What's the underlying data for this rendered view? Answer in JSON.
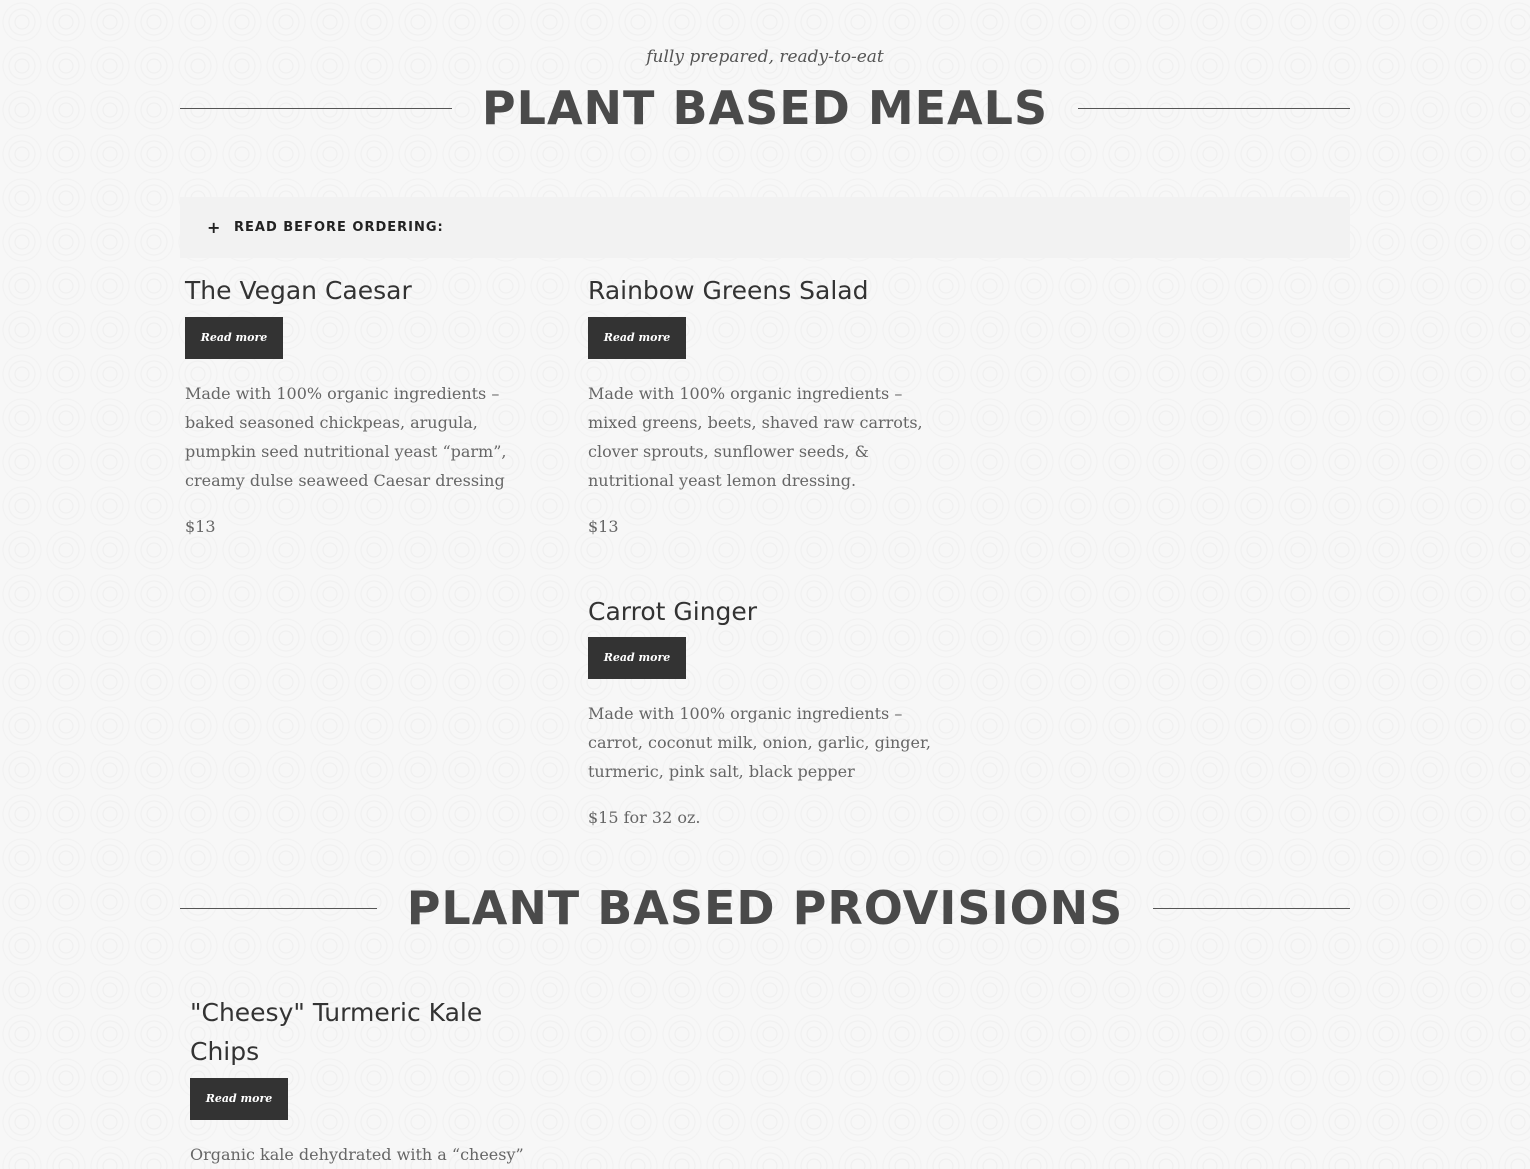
{
  "meals_section": {
    "kicker": "fully prepared, ready-to-eat",
    "title": "PLANT BASED MEALS"
  },
  "notice": {
    "icon": "plus-icon",
    "plus": "+",
    "label": "READ BEFORE ORDERING:"
  },
  "meals": [
    {
      "title": "The Vegan Caesar",
      "button": "Read more",
      "desc_lines": [
        "Made with 100% organic ingredients –",
        "baked seasoned chickpeas, arugula,",
        "pumpkin seed nutritional yeast “parm”,",
        "creamy dulse seaweed Caesar dressing"
      ],
      "price": "$13"
    },
    {
      "title": "Rainbow Greens Salad",
      "button": "Read more",
      "desc_lines": [
        "Made with 100% organic ingredients –",
        "mixed greens, beets, shaved raw carrots,",
        "clover sprouts, sunflower seeds, &",
        "nutritional yeast lemon dressing."
      ],
      "price": "$13"
    },
    {
      "title": "Carrot Ginger",
      "button": "Read more",
      "desc_lines": [
        "Made with 100% organic ingredients –",
        "carrot, coconut milk, onion, garlic, ginger,",
        "turmeric, pink salt, black pepper"
      ],
      "price": "$15 for 32 oz."
    }
  ],
  "provisions_section": {
    "title": "PLANT BASED PROVISIONS"
  },
  "provisions": [
    {
      "title_lines": [
        "\"Cheesy\" Turmeric Kale",
        "Chips"
      ],
      "button": "Read more",
      "desc_lines": [
        "Organic kale dehydrated with a “cheesy”"
      ]
    }
  ],
  "colors": {
    "background": "#f7f7f7",
    "button": "#333333",
    "heading": "#4a4a4a",
    "body_text": "#666666",
    "notice_bg": "#f2f2f2"
  }
}
